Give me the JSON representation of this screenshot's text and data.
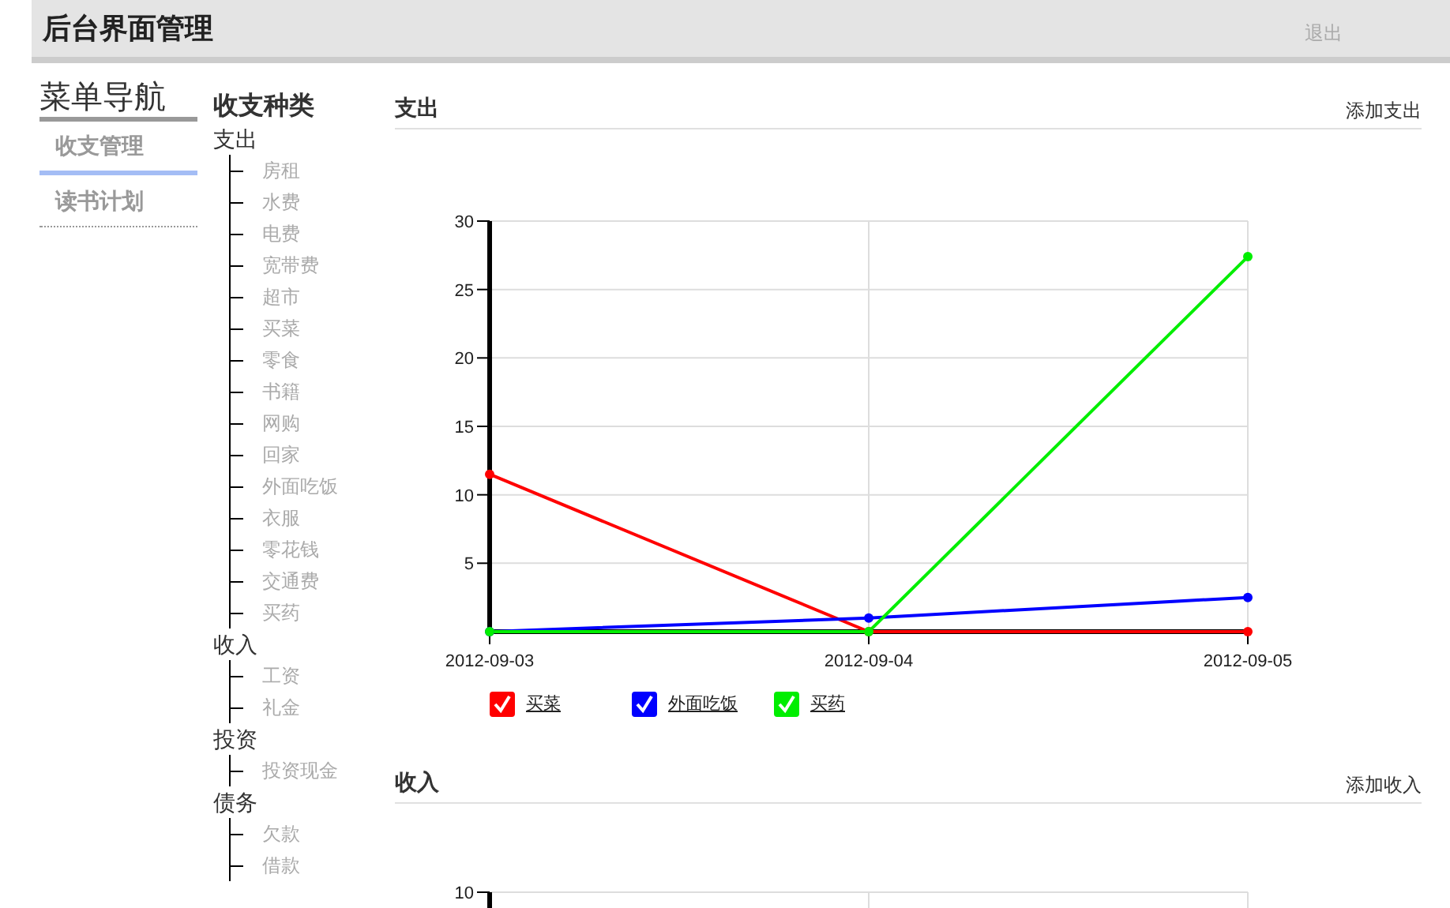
{
  "header": {
    "title": "后台界面管理",
    "logout": "退出"
  },
  "nav": {
    "title": "菜单导航",
    "items": [
      {
        "label": "收支管理",
        "selected": true
      },
      {
        "label": "读书计划",
        "selected": false
      }
    ]
  },
  "categories": {
    "title": "收支种类",
    "groups": [
      {
        "label": "支出",
        "children": [
          {
            "label": "房租"
          },
          {
            "label": "水费"
          },
          {
            "label": "电费"
          },
          {
            "label": "宽带费"
          },
          {
            "label": "超市"
          },
          {
            "label": "买菜"
          },
          {
            "label": "零食"
          },
          {
            "label": "书籍"
          },
          {
            "label": "网购"
          },
          {
            "label": "回家"
          },
          {
            "label": "外面吃饭"
          },
          {
            "label": "衣服"
          },
          {
            "label": "零花钱"
          },
          {
            "label": "交通费"
          },
          {
            "label": "买药"
          }
        ]
      },
      {
        "label": "收入",
        "children": [
          {
            "label": "工资"
          },
          {
            "label": "礼金"
          }
        ]
      },
      {
        "label": "投资",
        "children": [
          {
            "label": "投资现金"
          }
        ]
      },
      {
        "label": "债务",
        "children": [
          {
            "label": "欠款"
          },
          {
            "label": "借款"
          }
        ]
      }
    ]
  },
  "sections": [
    {
      "title": "支出",
      "action": "添加支出",
      "chart_data": {
        "type": "line",
        "grid": true,
        "categories": [
          "2012-09-03",
          "2012-09-04",
          "2012-09-05"
        ],
        "ylim": [
          0,
          30
        ],
        "yticks": [
          5,
          10,
          15,
          20,
          25,
          30
        ],
        "series": [
          {
            "name": "买菜",
            "color": "#ff0000",
            "marker": "circle",
            "values": [
              11.5,
              0,
              0
            ]
          },
          {
            "name": "外面吃饭",
            "color": "#0000ff",
            "marker": "circle",
            "values": [
              0,
              1,
              2.5
            ]
          },
          {
            "name": "买药",
            "color": "#00ee00",
            "marker": "circle",
            "values": [
              0,
              0,
              27.4
            ]
          }
        ]
      },
      "legend": [
        {
          "checked": true
        },
        {
          "checked": true
        },
        {
          "checked": true
        }
      ]
    },
    {
      "title": "收入",
      "action": "添加收入",
      "axis_label": "10"
    }
  ]
}
